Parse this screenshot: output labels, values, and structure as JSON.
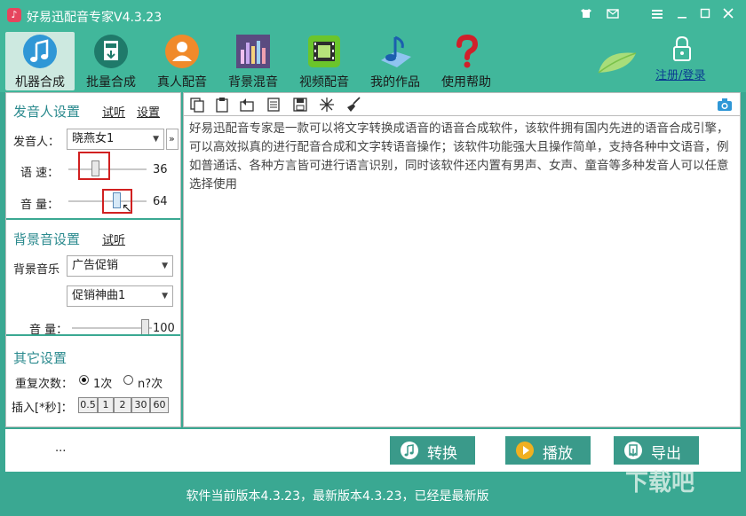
{
  "window": {
    "title": "好易迅配音专家V4.3.23",
    "controls": [
      "shirt-icon",
      "mail-icon",
      "menu-icon",
      "minimize-icon",
      "maximize-icon",
      "close-icon"
    ]
  },
  "toolbar": {
    "items": [
      {
        "label": "机器合成",
        "icon": "music-note-icon"
      },
      {
        "label": "批量合成",
        "icon": "mp3-file-icon"
      },
      {
        "label": "真人配音",
        "icon": "person-icon"
      },
      {
        "label": "背景混音",
        "icon": "equalizer-icon"
      },
      {
        "label": "视频配音",
        "icon": "film-icon"
      },
      {
        "label": "我的作品",
        "icon": "note-icon"
      },
      {
        "label": "使用帮助",
        "icon": "question-icon"
      }
    ],
    "register_link": "注册/登录"
  },
  "voice_settings": {
    "title": "发音人设置",
    "listen_link": "试听",
    "settings_link": "设置",
    "speaker_label": "发音人：",
    "speaker_value": "晓燕女1",
    "speaker_more": "»",
    "speed_label": "语 速：",
    "speed_value": "36",
    "speed_level": 36,
    "volume_label": "音 量：",
    "volume_value": "64",
    "volume_level": 64
  },
  "bg_settings": {
    "title": "背景音设置",
    "listen_link": "试听",
    "music_label": "背景音乐",
    "category_value": "广告促销",
    "track_value": "促销神曲1",
    "volume_label": "音 量：",
    "volume_value": "100",
    "volume_level": 100
  },
  "other_settings": {
    "title": "其它设置",
    "repeat_label": "重复次数：",
    "repeat_once": "1次",
    "repeat_n": "n?次",
    "insert_label": "插入[*秒]：",
    "insert_options": [
      "0.5",
      "1",
      "2",
      "30",
      "60"
    ]
  },
  "editor": {
    "text": "好易迅配音专家是一款可以将文字转换成语音的语音合成软件，该软件拥有国内先进的语音合成引擎，可以高效拟真的进行配音合成和文字转语音操作；该软件功能强大且操作简单，支持各种中文语音，例如普通话、各种方言皆可进行语言识别，同时该软件还内置有男声、女声、童音等多种发音人可以任意选择使用"
  },
  "actions": {
    "ellipsis": "...",
    "convert": "转换",
    "play": "播放",
    "export": "导出"
  },
  "status": {
    "text": "软件当前版本4.3.23，最新版本4.3.23，已经是最新版"
  },
  "watermark": "下载吧",
  "colors": {
    "primary": "#41b79b",
    "accent": "#3a9a8a",
    "section_title": "#2b8a8e",
    "highlight_box": "#d12020"
  }
}
